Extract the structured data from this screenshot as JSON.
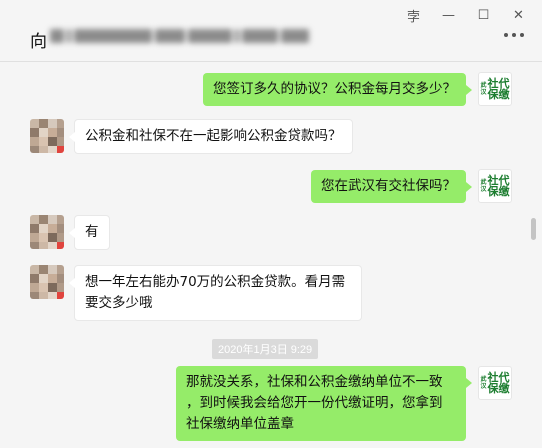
{
  "window": {
    "pin_glyph": "孛",
    "minimize_glyph": "—",
    "maximize_glyph": "☐",
    "close_glyph": "✕"
  },
  "header": {
    "title_prefix": "向",
    "more_glyph": "⋯"
  },
  "logo": {
    "small_top": "武",
    "small_bottom": "汉",
    "chars": [
      "社",
      "代",
      "保",
      "缴"
    ]
  },
  "messages": [
    {
      "from": "me",
      "text": "您签订多久的协议？公积金每月交多少？"
    },
    {
      "from": "other",
      "text": "公积金和社保不在一起影响公积金贷款吗？"
    },
    {
      "from": "me",
      "text": "您在武汉有交社保吗？"
    },
    {
      "from": "other",
      "text": "有"
    },
    {
      "from": "other",
      "line1": "想一年左右能办70万的公积金贷款。看月需",
      "line2": "要交多少哦"
    },
    {
      "from": "me",
      "line1": "那就没关系，社保和公积金缴纳单位不一致",
      "line2": "，到时候我会给您开一份代缴证明，您拿到",
      "line3": "社保缴纳单位盖章"
    }
  ],
  "timestamp": "2020年1月3日 9:29",
  "colors": {
    "my_bubble": "#95ec69",
    "other_bubble": "#ffffff",
    "logo_green": "#1c7d2f"
  }
}
